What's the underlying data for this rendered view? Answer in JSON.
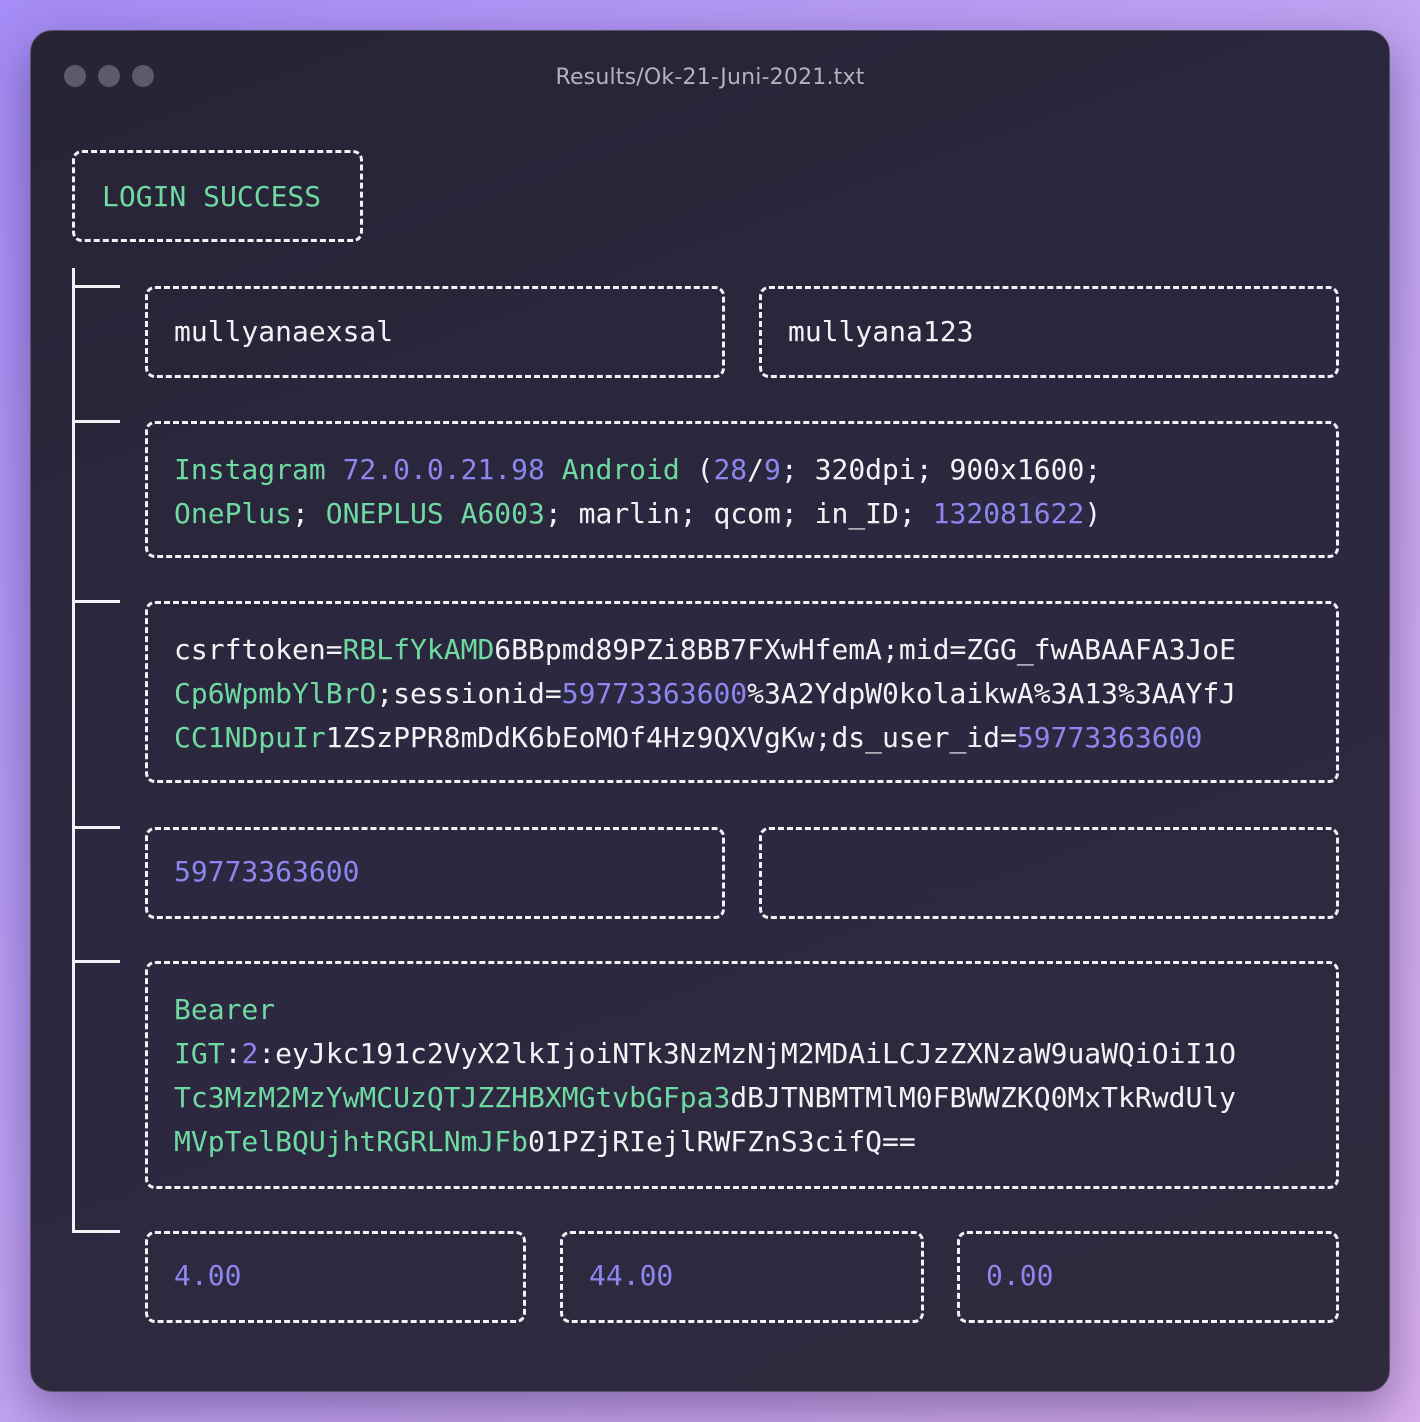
{
  "window": {
    "title": "Results/Ok-21-Juni-2021.txt",
    "traffic_light_color": "#5c5968"
  },
  "colors": {
    "green": "#6fd9a2",
    "purple": "#8d86ef",
    "white": "#f3f3f6",
    "border": "#f2f2f6"
  },
  "status": {
    "label": "LOGIN SUCCESS"
  },
  "credentials": {
    "username": "mullyanaexsal",
    "password": "mullyana123"
  },
  "user_agent": {
    "line1": [
      {
        "text": "Instagram ",
        "c": "g"
      },
      {
        "text": "72.0.0.21.98 ",
        "c": "p"
      },
      {
        "text": "Android ",
        "c": "g"
      },
      {
        "text": "(",
        "c": "w"
      },
      {
        "text": "28",
        "c": "p"
      },
      {
        "text": "/",
        "c": "w"
      },
      {
        "text": "9",
        "c": "p"
      },
      {
        "text": "; 320dpi; 900x1600;",
        "c": "w"
      }
    ],
    "line2": [
      {
        "text": "OnePlus",
        "c": "g"
      },
      {
        "text": "; ",
        "c": "w"
      },
      {
        "text": "ONEPLUS A6003",
        "c": "g"
      },
      {
        "text": "; marlin; qcom; in_ID; ",
        "c": "w"
      },
      {
        "text": "132081622",
        "c": "p"
      },
      {
        "text": ")",
        "c": "w"
      }
    ]
  },
  "cookie": {
    "line1": [
      {
        "text": "csrftoken=",
        "c": "w"
      },
      {
        "text": "RBLfYkAMD",
        "c": "g"
      },
      {
        "text": "6BBpmd89PZi8BB7FXwHfemA;mid=ZGG_fwABAAFA3JoE",
        "c": "w"
      }
    ],
    "line2": [
      {
        "text": "Cp6WpmbYlBrO",
        "c": "g"
      },
      {
        "text": ";sessionid=",
        "c": "w"
      },
      {
        "text": "59773363600",
        "c": "p"
      },
      {
        "text": "%3A2YdpW0kolaikwA%3A13%3AAYfJ",
        "c": "w"
      }
    ],
    "line3": [
      {
        "text": "CC1NDpuIr",
        "c": "g"
      },
      {
        "text": "1ZSzPPR8mDdK6bEoMOf4Hz9QXVgKw;ds_user_id=",
        "c": "w"
      },
      {
        "text": "59773363600",
        "c": "p"
      }
    ]
  },
  "user_id": {
    "value": "59773363600",
    "empty_field": ""
  },
  "bearer": {
    "line1": [
      {
        "text": "Bearer",
        "c": "g"
      }
    ],
    "line2": [
      {
        "text": "IGT",
        "c": "g"
      },
      {
        "text": ":",
        "c": "w"
      },
      {
        "text": "2",
        "c": "p"
      },
      {
        "text": ":eyJkc191c2VyX2lkIjoiNTk3NzMzNjM2MDAiLCJzZXNzaW9uaWQiOiI1O",
        "c": "w"
      }
    ],
    "line3": [
      {
        "text": "Tc3MzM2MzYwMCUzQTJZZHBXMGtvbGFpa3",
        "c": "g"
      },
      {
        "text": "dBJTNBMTMlM0FBWWZKQ0MxTkRwdUly",
        "c": "w"
      }
    ],
    "line4": [
      {
        "text": "MVpTelBQUjhtRGRLNmJFb",
        "c": "g"
      },
      {
        "text": "01PZjRIejlRWFZnS3cifQ==",
        "c": "w"
      }
    ]
  },
  "stats": {
    "a": "4.00",
    "b": "44.00",
    "c": "0.00"
  }
}
